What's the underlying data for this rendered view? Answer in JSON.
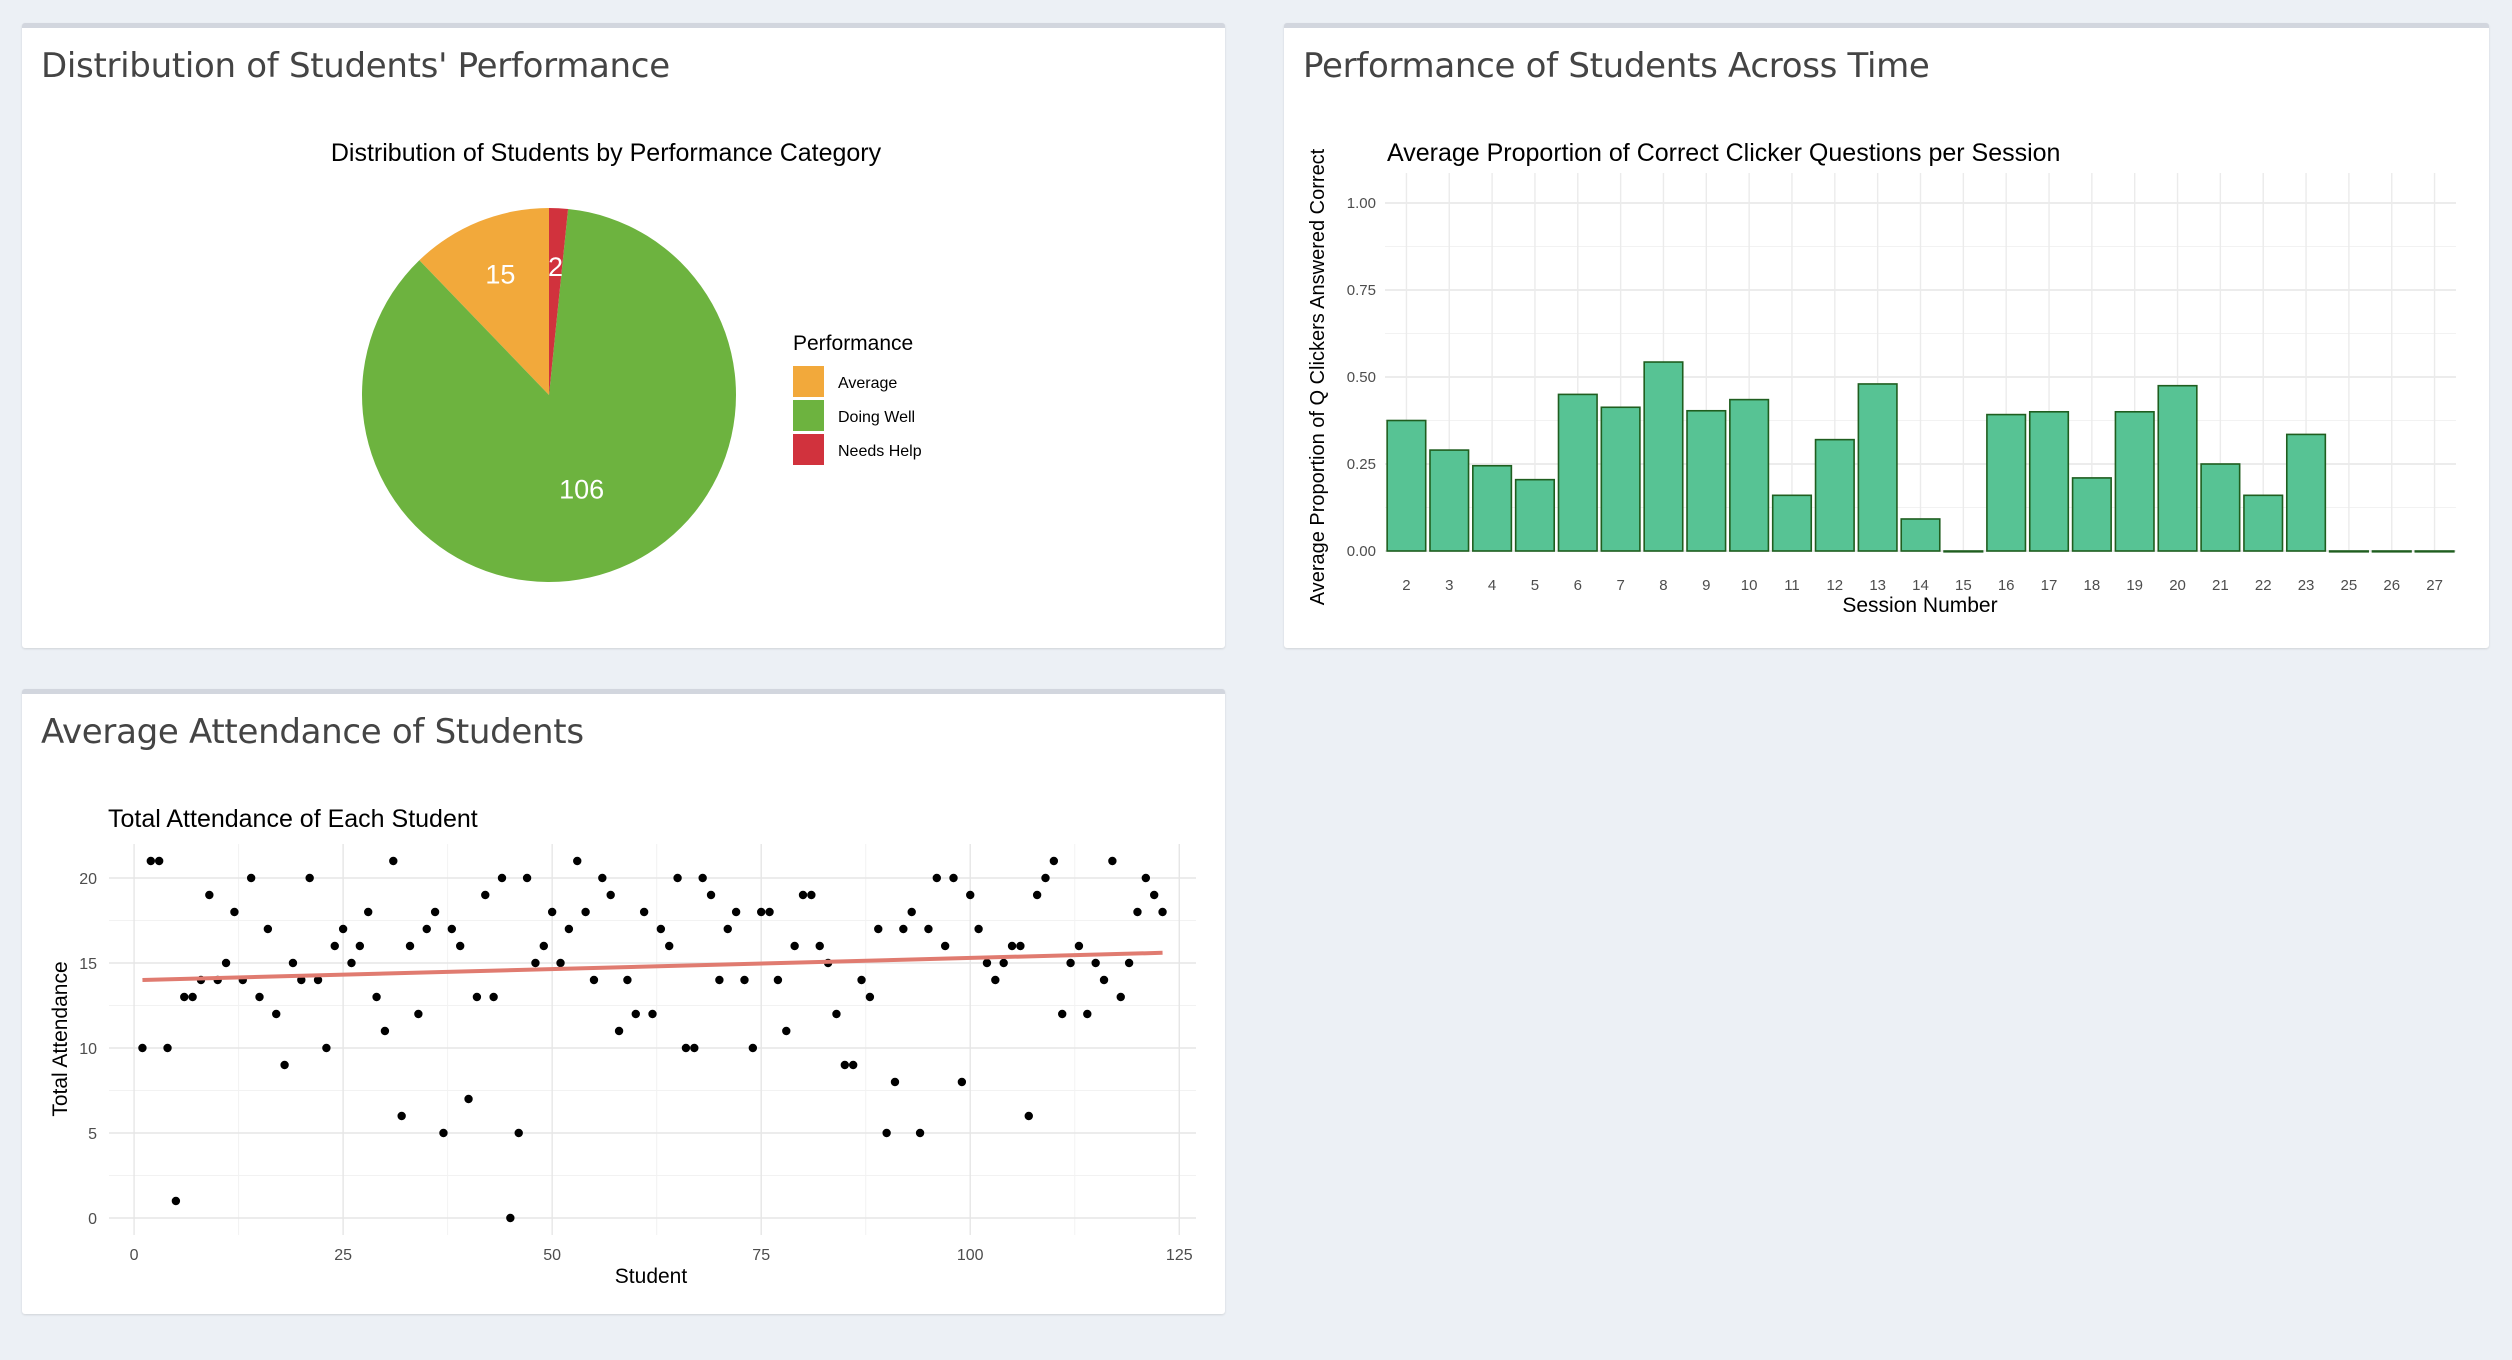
{
  "panels": {
    "performance": {
      "title": "Distribution of Students' Performance"
    },
    "time": {
      "title": "Performance of Students Across Time"
    },
    "attendance": {
      "title": "Average Attendance of Students"
    }
  },
  "chart_data": [
    {
      "id": "pie",
      "type": "pie",
      "title": "Distribution of Students by Performance Category",
      "legend_title": "Performance",
      "legend_position": "right",
      "slices": [
        {
          "label": "Average",
          "value": 15,
          "color": "#f2a93b"
        },
        {
          "label": "Doing Well",
          "value": 106,
          "color": "#6db33f"
        },
        {
          "label": "Needs Help",
          "value": 2,
          "color": "#d1323d"
        }
      ]
    },
    {
      "id": "bar",
      "type": "bar",
      "title": "Average Proportion of Correct Clicker Questions per Session",
      "xlabel": "Session Number",
      "ylabel": "Average Proportion of Q Clickers Answered Correct",
      "ylim": [
        0,
        1
      ],
      "yticks": [
        "0.00",
        "0.25",
        "0.50",
        "0.75",
        "1.00"
      ],
      "grid": true,
      "bar_color": "#57c394",
      "bar_border": "#1f5e1f",
      "categories": [
        "2",
        "3",
        "4",
        "5",
        "6",
        "7",
        "8",
        "9",
        "10",
        "11",
        "12",
        "13",
        "14",
        "15",
        "16",
        "17",
        "18",
        "19",
        "20",
        "21",
        "22",
        "23",
        "25",
        "26",
        "27"
      ],
      "values": [
        0.375,
        0.29,
        0.245,
        0.205,
        0.45,
        0.413,
        0.543,
        0.403,
        0.435,
        0.16,
        0.32,
        0.48,
        0.092,
        0.0,
        0.392,
        0.4,
        0.21,
        0.4,
        0.475,
        0.25,
        0.16,
        0.335,
        0.0,
        0.0,
        0.0
      ]
    },
    {
      "id": "scatter",
      "type": "scatter",
      "title": "Total Attendance of Each Student",
      "xlabel": "Student",
      "ylabel": "Total Attendance",
      "xlim": [
        -3,
        127
      ],
      "ylim": [
        -1,
        22
      ],
      "xticks": [
        0,
        25,
        50,
        75,
        100,
        125
      ],
      "yticks": [
        0,
        5,
        10,
        15,
        20
      ],
      "grid": true,
      "trend": {
        "x": [
          1,
          123
        ],
        "y": [
          14.0,
          15.6
        ],
        "color": "#e07b70"
      },
      "points": [
        [
          1,
          10
        ],
        [
          2,
          21
        ],
        [
          3,
          21
        ],
        [
          4,
          10
        ],
        [
          5,
          1
        ],
        [
          6,
          13
        ],
        [
          7,
          13
        ],
        [
          8,
          14
        ],
        [
          9,
          19
        ],
        [
          10,
          14
        ],
        [
          11,
          15
        ],
        [
          12,
          18
        ],
        [
          13,
          14
        ],
        [
          14,
          20
        ],
        [
          15,
          13
        ],
        [
          16,
          17
        ],
        [
          17,
          12
        ],
        [
          18,
          9
        ],
        [
          19,
          15
        ],
        [
          20,
          14
        ],
        [
          21,
          20
        ],
        [
          22,
          14
        ],
        [
          23,
          10
        ],
        [
          24,
          16
        ],
        [
          25,
          17
        ],
        [
          26,
          15
        ],
        [
          27,
          16
        ],
        [
          28,
          18
        ],
        [
          29,
          13
        ],
        [
          30,
          11
        ],
        [
          31,
          21
        ],
        [
          32,
          6
        ],
        [
          33,
          16
        ],
        [
          34,
          12
        ],
        [
          35,
          17
        ],
        [
          36,
          18
        ],
        [
          37,
          5
        ],
        [
          38,
          17
        ],
        [
          39,
          16
        ],
        [
          40,
          7
        ],
        [
          41,
          13
        ],
        [
          42,
          19
        ],
        [
          43,
          13
        ],
        [
          44,
          20
        ],
        [
          45,
          0
        ],
        [
          46,
          5
        ],
        [
          47,
          20
        ],
        [
          48,
          15
        ],
        [
          49,
          16
        ],
        [
          50,
          18
        ],
        [
          51,
          15
        ],
        [
          52,
          17
        ],
        [
          53,
          21
        ],
        [
          54,
          18
        ],
        [
          55,
          14
        ],
        [
          56,
          20
        ],
        [
          57,
          19
        ],
        [
          58,
          11
        ],
        [
          59,
          14
        ],
        [
          60,
          12
        ],
        [
          61,
          18
        ],
        [
          62,
          12
        ],
        [
          63,
          17
        ],
        [
          64,
          16
        ],
        [
          65,
          20
        ],
        [
          66,
          10
        ],
        [
          67,
          10
        ],
        [
          68,
          20
        ],
        [
          69,
          19
        ],
        [
          70,
          14
        ],
        [
          71,
          17
        ],
        [
          72,
          18
        ],
        [
          73,
          14
        ],
        [
          74,
          10
        ],
        [
          75,
          18
        ],
        [
          76,
          18
        ],
        [
          77,
          14
        ],
        [
          78,
          11
        ],
        [
          79,
          16
        ],
        [
          80,
          19
        ],
        [
          81,
          19
        ],
        [
          82,
          16
        ],
        [
          83,
          15
        ],
        [
          84,
          12
        ],
        [
          85,
          9
        ],
        [
          86,
          9
        ],
        [
          87,
          14
        ],
        [
          88,
          13
        ],
        [
          89,
          17
        ],
        [
          90,
          5
        ],
        [
          91,
          8
        ],
        [
          92,
          17
        ],
        [
          93,
          18
        ],
        [
          94,
          5
        ],
        [
          95,
          17
        ],
        [
          96,
          20
        ],
        [
          97,
          16
        ],
        [
          98,
          20
        ],
        [
          99,
          8
        ],
        [
          100,
          19
        ],
        [
          101,
          17
        ],
        [
          102,
          15
        ],
        [
          103,
          14
        ],
        [
          104,
          15
        ],
        [
          105,
          16
        ],
        [
          106,
          16
        ],
        [
          107,
          6
        ],
        [
          108,
          19
        ],
        [
          109,
          20
        ],
        [
          110,
          21
        ],
        [
          111,
          12
        ],
        [
          112,
          15
        ],
        [
          113,
          16
        ],
        [
          114,
          12
        ],
        [
          115,
          15
        ],
        [
          116,
          14
        ],
        [
          117,
          21
        ],
        [
          118,
          13
        ],
        [
          119,
          15
        ],
        [
          120,
          18
        ],
        [
          121,
          20
        ],
        [
          122,
          19
        ],
        [
          123,
          18
        ]
      ]
    }
  ]
}
